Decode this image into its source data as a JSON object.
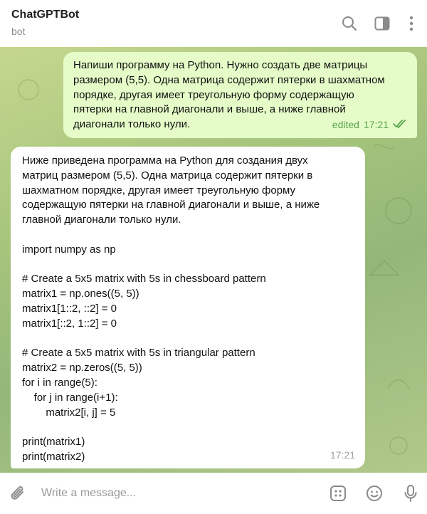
{
  "header": {
    "title": "ChatGPTBot",
    "status": "bot",
    "icons": [
      "search-icon",
      "sidebar-toggle-icon",
      "more-vertical-icon"
    ]
  },
  "messages": {
    "outgoing": {
      "lines": [
        "Напиши программу на Python. Нужно создать две матрицы",
        "размером (5,5). Одна матрица содержит пятерки в шахматном",
        "порядке, другая имеет треугольную форму содержащую",
        "пятерки на главной диагонали и выше, а ниже главной",
        "диагонали только нули."
      ],
      "edited_label": "edited",
      "time": "17:21",
      "status_icon": "double-check-icon"
    },
    "incoming": {
      "lines": [
        "Ниже приведена программа на Python для создания двух",
        "матриц размером (5,5). Одна матрица содержит пятерки в",
        "шахматном порядке, другая имеет треугольную форму",
        "содержащую пятерки на главной диагонали и выше, а ниже",
        "главной диагонали только нули.",
        "",
        "import numpy as np",
        "",
        "# Create a 5x5 matrix with 5s in chessboard pattern",
        "matrix1 = np.ones((5, 5))",
        "matrix1[1::2, ::2] = 0",
        "matrix1[::2, 1::2] = 0",
        "",
        "# Create a 5x5 matrix with 5s in triangular pattern",
        "matrix2 = np.zeros((5, 5))",
        "for i in range(5):",
        "    for j in range(i+1):",
        "        matrix2[i, j] = 5",
        "",
        "print(matrix1)",
        "print(matrix2)"
      ],
      "time": "17:21"
    }
  },
  "composer": {
    "placeholder": "Write a message...",
    "value": "",
    "icons": [
      "paperclip-icon",
      "bot-commands-icon",
      "emoji-icon",
      "microphone-icon"
    ]
  },
  "colors": {
    "outgoing_bubble": "#e5fcc8",
    "incoming_bubble": "#ffffff",
    "accent_green": "#5aa64f",
    "icon_gray": "#8a8a8a"
  }
}
